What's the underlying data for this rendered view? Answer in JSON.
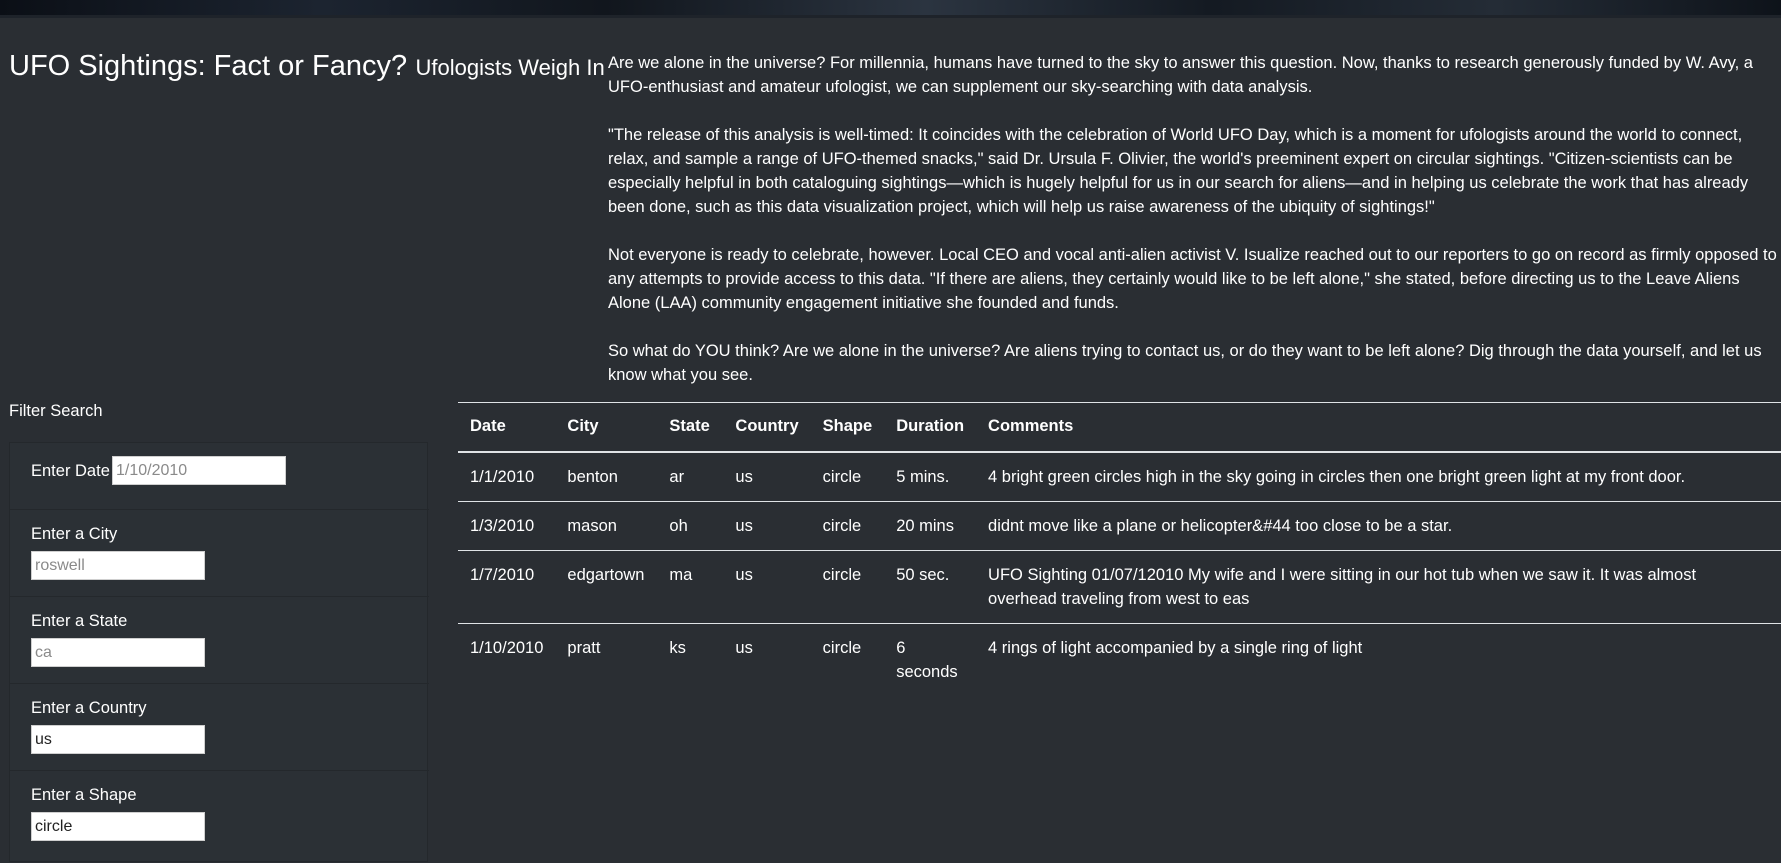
{
  "header": {
    "title": "UFO Sightings: Fact or Fancy?",
    "subtitle": "Ufologists Weigh In"
  },
  "intro": {
    "paragraphs": [
      "Are we alone in the universe? For millennia, humans have turned to the sky to answer this question. Now, thanks to research generously funded by W. Avy, a UFO-enthusiast and amateur ufologist, we can supplement our sky-searching with data analysis.",
      "\"The release of this analysis is well-timed: It coincides with the celebration of World UFO Day, which is a moment for ufologists around the world to connect, relax, and sample a range of UFO-themed snacks,\" said Dr. Ursula F. Olivier, the world's preeminent expert on circular sightings. \"Citizen-scientists can be especially helpful in both cataloguing sightings—which is hugely helpful for us in our search for aliens—and in helping us celebrate the work that has already been done, such as this data visualization project, which will help us raise awareness of the ubiquity of sightings!\"",
      "Not everyone is ready to celebrate, however. Local CEO and vocal anti-alien activist V. Isualize reached out to our reporters to go on record as firmly opposed to any attempts to provide access to this data. \"If there are aliens, they certainly would like to be left alone,\" she stated, before directing us to the Leave Aliens Alone (LAA) community engagement initiative she founded and funds.",
      "So what do YOU think? Are we alone in the universe? Are aliens trying to contact us, or do they want to be left alone? Dig through the data yourself, and let us know what you see."
    ]
  },
  "filters": {
    "heading": "Filter Search",
    "date": {
      "label": "Enter Date",
      "value": "",
      "placeholder": "1/10/2010"
    },
    "city": {
      "label": "Enter a City",
      "value": "",
      "placeholder": "roswell"
    },
    "state": {
      "label": "Enter a State",
      "value": "",
      "placeholder": "ca"
    },
    "country": {
      "label": "Enter a Country",
      "value": "us",
      "placeholder": ""
    },
    "shape": {
      "label": "Enter a Shape",
      "value": "circle",
      "placeholder": ""
    }
  },
  "table": {
    "headers": {
      "date": "Date",
      "city": "City",
      "state": "State",
      "country": "Country",
      "shape": "Shape",
      "duration": "Duration",
      "comments": "Comments"
    },
    "rows": [
      {
        "date": "1/1/2010",
        "city": "benton",
        "state": "ar",
        "country": "us",
        "shape": "circle",
        "duration": "5 mins.",
        "comments": "4 bright green circles high in the sky going in circles then one bright green light at my front door."
      },
      {
        "date": "1/3/2010",
        "city": "mason",
        "state": "oh",
        "country": "us",
        "shape": "circle",
        "duration": "20 mins",
        "comments": "didnt move like a plane or helicopter&#44 too close to be a star."
      },
      {
        "date": "1/7/2010",
        "city": "edgartown",
        "state": "ma",
        "country": "us",
        "shape": "circle",
        "duration": "50 sec.",
        "comments": "UFO Sighting 01/07/12010 My wife and I were sitting in our hot tub when we saw it. It was almost overhead traveling from west to eas"
      },
      {
        "date": "1/10/2010",
        "city": "pratt",
        "state": "ks",
        "country": "us",
        "shape": "circle",
        "duration": "6 seconds",
        "comments": "4 rings of light accompanied by a single ring of light"
      }
    ]
  }
}
